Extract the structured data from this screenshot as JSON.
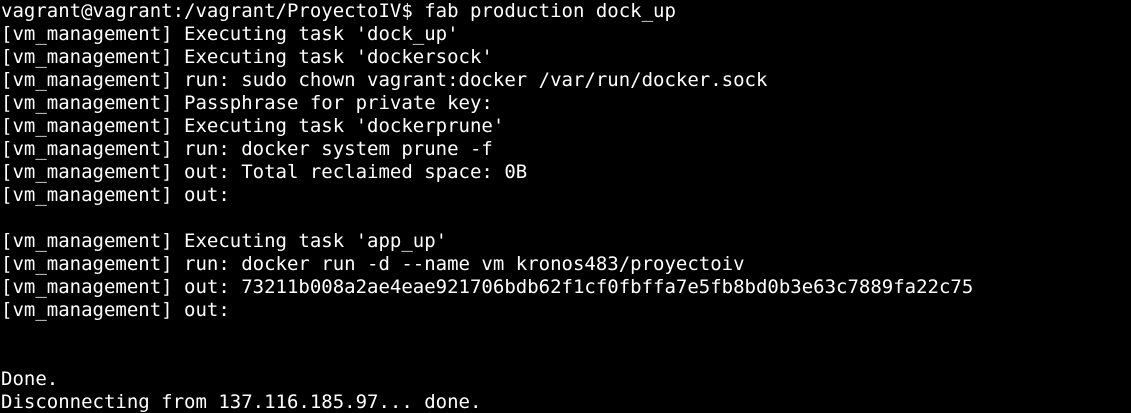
{
  "terminal": {
    "colors": {
      "background": "#000000",
      "foreground": "#ffffff"
    },
    "lines": [
      "vagrant@vagrant:/vagrant/ProyectoIV$ fab production dock_up",
      "[vm_management] Executing task 'dock_up'",
      "[vm_management] Executing task 'dockersock'",
      "[vm_management] run: sudo chown vagrant:docker /var/run/docker.sock",
      "[vm_management] Passphrase for private key:",
      "[vm_management] Executing task 'dockerprune'",
      "[vm_management] run: docker system prune -f",
      "[vm_management] out: Total reclaimed space: 0B",
      "[vm_management] out:",
      "",
      "[vm_management] Executing task 'app_up'",
      "[vm_management] run: docker run -d --name vm kronos483/proyectoiv",
      "[vm_management] out: 73211b008a2ae4eae921706bdb62f1cf0fbffa7e5fb8bd0b3e63c7889fa22c75",
      "[vm_management] out:",
      "",
      "",
      "Done.",
      "Disconnecting from 137.116.185.97... done."
    ]
  }
}
